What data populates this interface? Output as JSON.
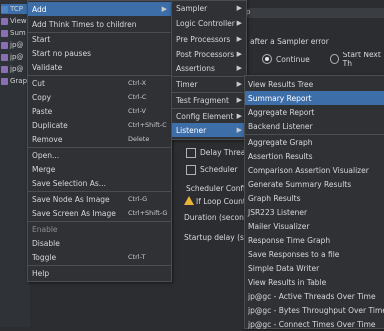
{
  "tree": {
    "items": [
      {
        "label": "TCP",
        "icon": "testplan-icon"
      },
      {
        "label": "View",
        "icon": "listener-icon"
      },
      {
        "label": "Sum",
        "icon": "listener-icon"
      },
      {
        "label": "jp@",
        "icon": "listener-icon"
      },
      {
        "label": "jp@",
        "icon": "listener-icon"
      },
      {
        "label": "jp@",
        "icon": "listener-icon"
      },
      {
        "label": "Grap",
        "icon": "listener-icon"
      }
    ]
  },
  "background": {
    "top_field_text": "ıp",
    "after_error_label": "after a Sampler error",
    "continue_label": "Continue",
    "start_next_label": "Start Next Th",
    "delay_thread_label": "Delay Threa",
    "scheduler_label": "Scheduler",
    "scheduler_config_label": "Scheduler Config",
    "if_loop_count_label": "If Loop Count",
    "duration_label": "Duration (second",
    "startup_delay_label": "Startup delay (se"
  },
  "context_menu": {
    "items": [
      {
        "label": "Add",
        "shortcut": "",
        "submenu": true,
        "active": true
      },
      {
        "label": "Add Think Times to children",
        "shortcut": "",
        "submenu": false
      },
      {
        "label": "Start",
        "shortcut": "",
        "submenu": false
      },
      {
        "label": "Start no pauses",
        "shortcut": "",
        "submenu": false
      },
      {
        "label": "Validate",
        "shortcut": "",
        "submenu": false
      },
      {
        "label": "Cut",
        "shortcut": "Ctrl-X",
        "submenu": false
      },
      {
        "label": "Copy",
        "shortcut": "Ctrl-C",
        "submenu": false
      },
      {
        "label": "Paste",
        "shortcut": "Ctrl-V",
        "submenu": false
      },
      {
        "label": "Duplicate",
        "shortcut": "Ctrl+Shift-C",
        "submenu": false
      },
      {
        "label": "Remove",
        "shortcut": "Delete",
        "submenu": false
      },
      {
        "label": "Open...",
        "shortcut": "",
        "submenu": false
      },
      {
        "label": "Merge",
        "shortcut": "",
        "submenu": false
      },
      {
        "label": "Save Selection As...",
        "shortcut": "",
        "submenu": false
      },
      {
        "label": "Save Node As Image",
        "shortcut": "Ctrl-G",
        "submenu": false
      },
      {
        "label": "Save Screen As Image",
        "shortcut": "Ctrl+Shift-G",
        "submenu": false
      },
      {
        "label": "Enable",
        "shortcut": "",
        "submenu": false,
        "disabled": true
      },
      {
        "label": "Disable",
        "shortcut": "",
        "submenu": false
      },
      {
        "label": "Toggle",
        "shortcut": "Ctrl-T",
        "submenu": false
      },
      {
        "label": "Help",
        "shortcut": "",
        "submenu": false
      }
    ]
  },
  "add_menu": {
    "items": [
      {
        "label": "Sampler"
      },
      {
        "label": "Logic Controller"
      },
      {
        "label": "Pre Processors"
      },
      {
        "label": "Post Processors"
      },
      {
        "label": "Assertions"
      },
      {
        "label": "Timer"
      },
      {
        "label": "Test Fragment"
      },
      {
        "label": "Config Element"
      },
      {
        "label": "Listener"
      }
    ]
  },
  "listener_menu": {
    "items": [
      {
        "label": "View Results Tree"
      },
      {
        "label": "Summary Report"
      },
      {
        "label": "Aggregate Report"
      },
      {
        "label": "Backend Listener"
      },
      {
        "label": "Aggregate Graph"
      },
      {
        "label": "Assertion Results"
      },
      {
        "label": "Comparison Assertion Visualizer"
      },
      {
        "label": "Generate Summary Results"
      },
      {
        "label": "Graph Results"
      },
      {
        "label": "JSR223 Listener"
      },
      {
        "label": "Mailer Visualizer"
      },
      {
        "label": "Response Time Graph"
      },
      {
        "label": "Save Responses to a file"
      },
      {
        "label": "Simple Data Writer"
      },
      {
        "label": "View Results in Table"
      },
      {
        "label": "jp@gc - Active Threads Over Time"
      },
      {
        "label": "jp@gc - Bytes Throughput Over Time"
      },
      {
        "label": "jp@gc - Connect Times Over Time"
      }
    ]
  },
  "colors": {
    "highlight": "#3d6ea8",
    "menu_bg": "#2f3134",
    "text": "#d6d9dd"
  }
}
